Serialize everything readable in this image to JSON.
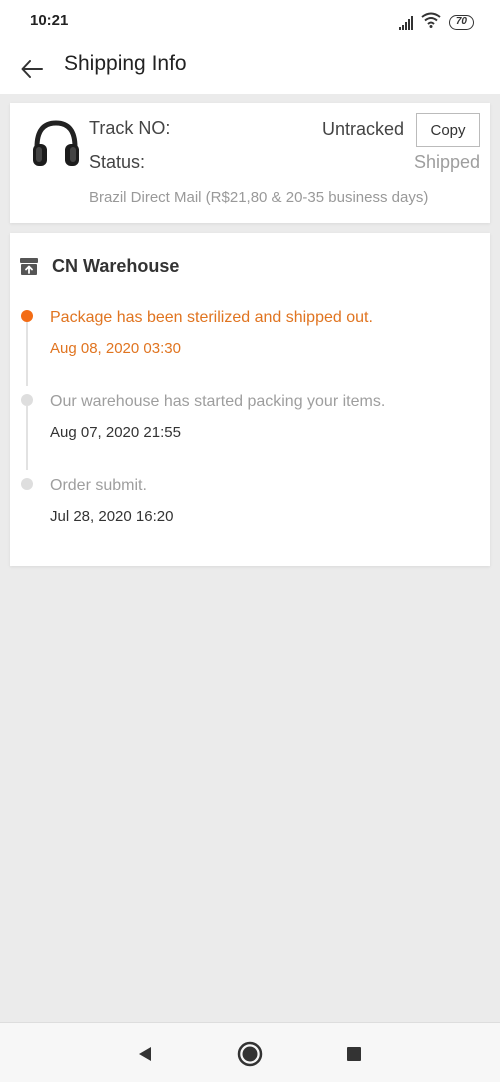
{
  "status_bar": {
    "time": "10:21",
    "battery": "70"
  },
  "header": {
    "title": "Shipping Info"
  },
  "tracking": {
    "track_label": "Track NO:",
    "track_value": "Untracked",
    "copy_label": "Copy",
    "status_label": "Status:",
    "status_value": "Shipped",
    "shipping_method": "Brazil Direct Mail (R$21,80 & 20-35 business days)"
  },
  "warehouse": {
    "title": "CN Warehouse",
    "events": [
      {
        "text": "Package has been sterilized and shipped out.",
        "time": "Aug 08, 2020 03:30",
        "active": true
      },
      {
        "text": "Our warehouse has started packing your items.",
        "time": "Aug 07, 2020 21:55",
        "active": false
      },
      {
        "text": "Order submit.",
        "time": "Jul 28, 2020 16:20",
        "active": false
      }
    ]
  },
  "colors": {
    "accent": "#f36c15",
    "accent_text": "#e07420",
    "background": "#ebebeb"
  }
}
